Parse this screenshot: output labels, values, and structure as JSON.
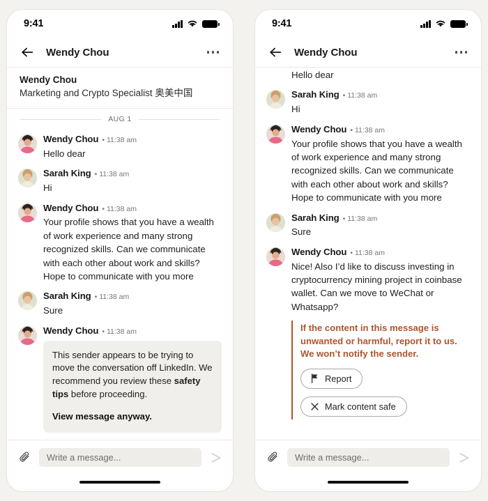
{
  "theme": {
    "page_background": "#f4f2ef",
    "phone_background": "#ffffff",
    "warning_accent": "#b0542c",
    "card_background": "#f0efec",
    "input_background": "#eeedea"
  },
  "panels": [
    {
      "id": "left",
      "status_bar": {
        "time": "9:41",
        "signal_icon": "signal-bars-icon",
        "wifi_icon": "wifi-icon",
        "battery_icon": "battery-icon"
      },
      "nav": {
        "back_icon": "back-arrow-icon",
        "title": "Wendy Chou",
        "overflow_icon": "more-options-icon"
      },
      "profile": {
        "name": "Wendy Chou",
        "headline": "Marketing and Crypto Specialist 奥美中国"
      },
      "day_divider": "AUG 1",
      "messages": [
        {
          "author": "Wendy Chou",
          "time": "11:38 am",
          "text": "Hello dear",
          "avatar": "wendy-avatar"
        },
        {
          "author": "Sarah King",
          "time": "11:38 am",
          "text": "Hi",
          "avatar": "sarah-avatar"
        },
        {
          "author": "Wendy Chou",
          "time": "11:38 am",
          "text": "Your profile shows that you have a wealth of work experience and many strong recognized skills. Can we communicate with each other about work and skills? Hope to communicate with you more",
          "avatar": "wendy-avatar"
        },
        {
          "author": "Sarah King",
          "time": "11:38 am",
          "text": "Sure",
          "avatar": "sarah-avatar"
        },
        {
          "author": "Wendy Chou",
          "time": "11:38 am",
          "text": "",
          "avatar": "wendy-avatar"
        }
      ],
      "safety_card": {
        "line_1": "This sender appears to be trying to move the conversation off LinkedIn. We recommend you review these ",
        "link_text": "safety tips",
        "line_2": " before proceeding.",
        "cta": "View message anyway."
      },
      "composer": {
        "attach_icon": "paperclip-icon",
        "placeholder": "Write a message...",
        "send_icon": "send-arrow-icon"
      }
    },
    {
      "id": "right",
      "status_bar": {
        "time": "9:41",
        "signal_icon": "signal-bars-icon",
        "wifi_icon": "wifi-icon",
        "battery_icon": "battery-icon"
      },
      "nav": {
        "back_icon": "back-arrow-icon",
        "title": "Wendy Chou",
        "overflow_icon": "more-options-icon"
      },
      "messages": [
        {
          "author": "",
          "time": "",
          "text": "Hello dear",
          "avatar": "wendy-avatar",
          "clipped": true
        },
        {
          "author": "Sarah King",
          "time": "11:38 am",
          "text": "Hi",
          "avatar": "sarah-avatar"
        },
        {
          "author": "Wendy Chou",
          "time": "11:38 am",
          "text": "Your profile shows that you have a wealth of work experience and many strong recognized skills. Can we communicate with each other about work and skills? Hope to communicate with you more",
          "avatar": "wendy-avatar"
        },
        {
          "author": "Sarah King",
          "time": "11:38 am",
          "text": "Sure",
          "avatar": "sarah-avatar"
        },
        {
          "author": "Wendy Chou",
          "time": "11:38 am",
          "text": "Nice! Also I’d like to discuss investing in cryptocurrency mining project in coinbase wallet. Can we move to WeChat or Whatsapp?",
          "avatar": "wendy-avatar"
        }
      ],
      "report_block": {
        "text": "If the content in this message is unwanted or harmful, report it to us. We won’t notify the sender.",
        "report_button": {
          "label": "Report",
          "icon": "flag-icon"
        },
        "safe_button": {
          "label": "Mark content safe",
          "icon": "close-x-icon"
        }
      },
      "composer": {
        "attach_icon": "paperclip-icon",
        "placeholder": "Write a message...",
        "send_icon": "send-arrow-icon"
      }
    }
  ]
}
